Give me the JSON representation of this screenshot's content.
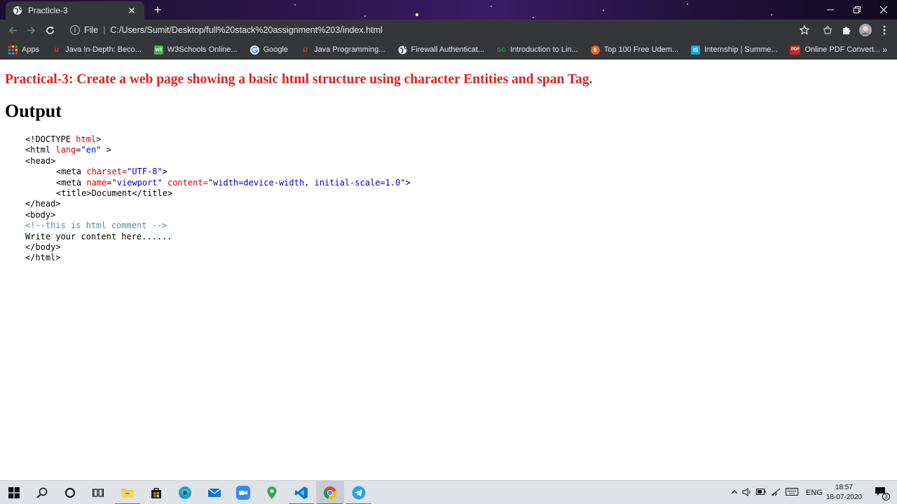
{
  "browser": {
    "tab_title": "Practicle-3",
    "new_tab": "+",
    "omnibox": {
      "scheme_label": "File",
      "separator": "|",
      "url": "C:/Users/Sumit/Desktop/full%20stack%20assignment%203/index.html"
    },
    "bookmarks": [
      {
        "label": "Apps",
        "icon": "apps-grid-icon"
      },
      {
        "label": "Java In-Depth: Beco...",
        "icon": "udemy-icon"
      },
      {
        "label": "W3Schools Online...",
        "icon": "w3schools-icon"
      },
      {
        "label": "Google",
        "icon": "google-icon"
      },
      {
        "label": "Java Programming...",
        "icon": "udemy-icon"
      },
      {
        "label": "Firewall Authenticat...",
        "icon": "globe-icon"
      },
      {
        "label": "Introduction to Lin...",
        "icon": "geeksforgeeks-icon"
      },
      {
        "label": "Top 100 Free Udem...",
        "icon": "udemy-orange-icon"
      },
      {
        "label": "Internship | Summe...",
        "icon": "internshala-icon"
      },
      {
        "label": "Online PDF Convert...",
        "icon": "pdf-icon"
      }
    ],
    "bookmarks_more": "»"
  },
  "page": {
    "heading": "Practical-3: Create a web page showing a basic html structure using character Entities and span Tag.",
    "subheading": "Output",
    "code": {
      "l1_a": "<!DOCTYPE ",
      "l1_b": "html",
      "l1_c": ">",
      "l2_a": "<html ",
      "l2_b": "lang",
      "l2_c": "=",
      "l2_d": "\"en\"",
      "l2_e": " >",
      "l3": "<head>",
      "l4_a": "<meta ",
      "l4_b": "charset",
      "l4_c": "=",
      "l4_d": "\"UTF-8\"",
      "l4_e": ">",
      "l5_a": "<meta ",
      "l5_b": "name",
      "l5_c": "=",
      "l5_d": "\"viewport\"",
      "l5_e": " ",
      "l5_f": "content",
      "l5_g": "=",
      "l5_h": "\"width=device-width, initial-scale=1.0\"",
      "l5_i": ">",
      "l6": "<title>Document</title>",
      "l7": "</head>",
      "l8": "<body>",
      "l9": "<!--this is html comment -->",
      "l10": "Write your content here......",
      "l11": "</body>",
      "l12": "</html>"
    }
  },
  "taskbar": {
    "tray_lang": "ENG",
    "time": "18:57",
    "date": "18-07-2020",
    "notification_count": "3"
  },
  "colors": {
    "heading": "#e02020",
    "keyword": "#d40000",
    "string": "#0000c8",
    "comment": "#4f8ea8"
  }
}
